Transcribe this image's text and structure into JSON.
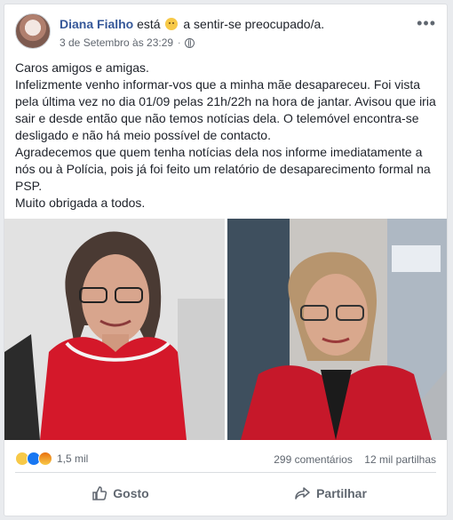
{
  "header": {
    "name": "Diana Fialho",
    "status_prefix": "está",
    "status_suffix": "a sentir-se preocupado/a.",
    "timestamp": "3 de Setembro às 23:29",
    "more_icon": "more-options-icon"
  },
  "post": {
    "paragraphs": [
      "Caros amigos e amigas.",
      "Infelizmente venho informar-vos que a minha mãe desapareceu. Foi vista pela última vez no dia 01/09 pelas 21h/22h na hora de jantar. Avisou que iria sair e desde então que não temos notícias dela. O telemóvel encontra-se desligado e não há meio possível de contacto.",
      "Agradecemos que quem tenha notícias dela nos informe imediatamente a nós ou à Polícia, pois já foi feito um relatório de desaparecimento formal na PSP.",
      "Muito obrigada a todos."
    ]
  },
  "engagement": {
    "reaction_count": "1,5 mil",
    "comments": "299 comentários",
    "shares": "12 mil partilhas"
  },
  "actions": {
    "like_label": "Gosto",
    "share_label": "Partilhar"
  },
  "colors": {
    "brand_link": "#365899",
    "text": "#1d2129",
    "muted": "#606770",
    "dress_red": "#d4182a"
  }
}
